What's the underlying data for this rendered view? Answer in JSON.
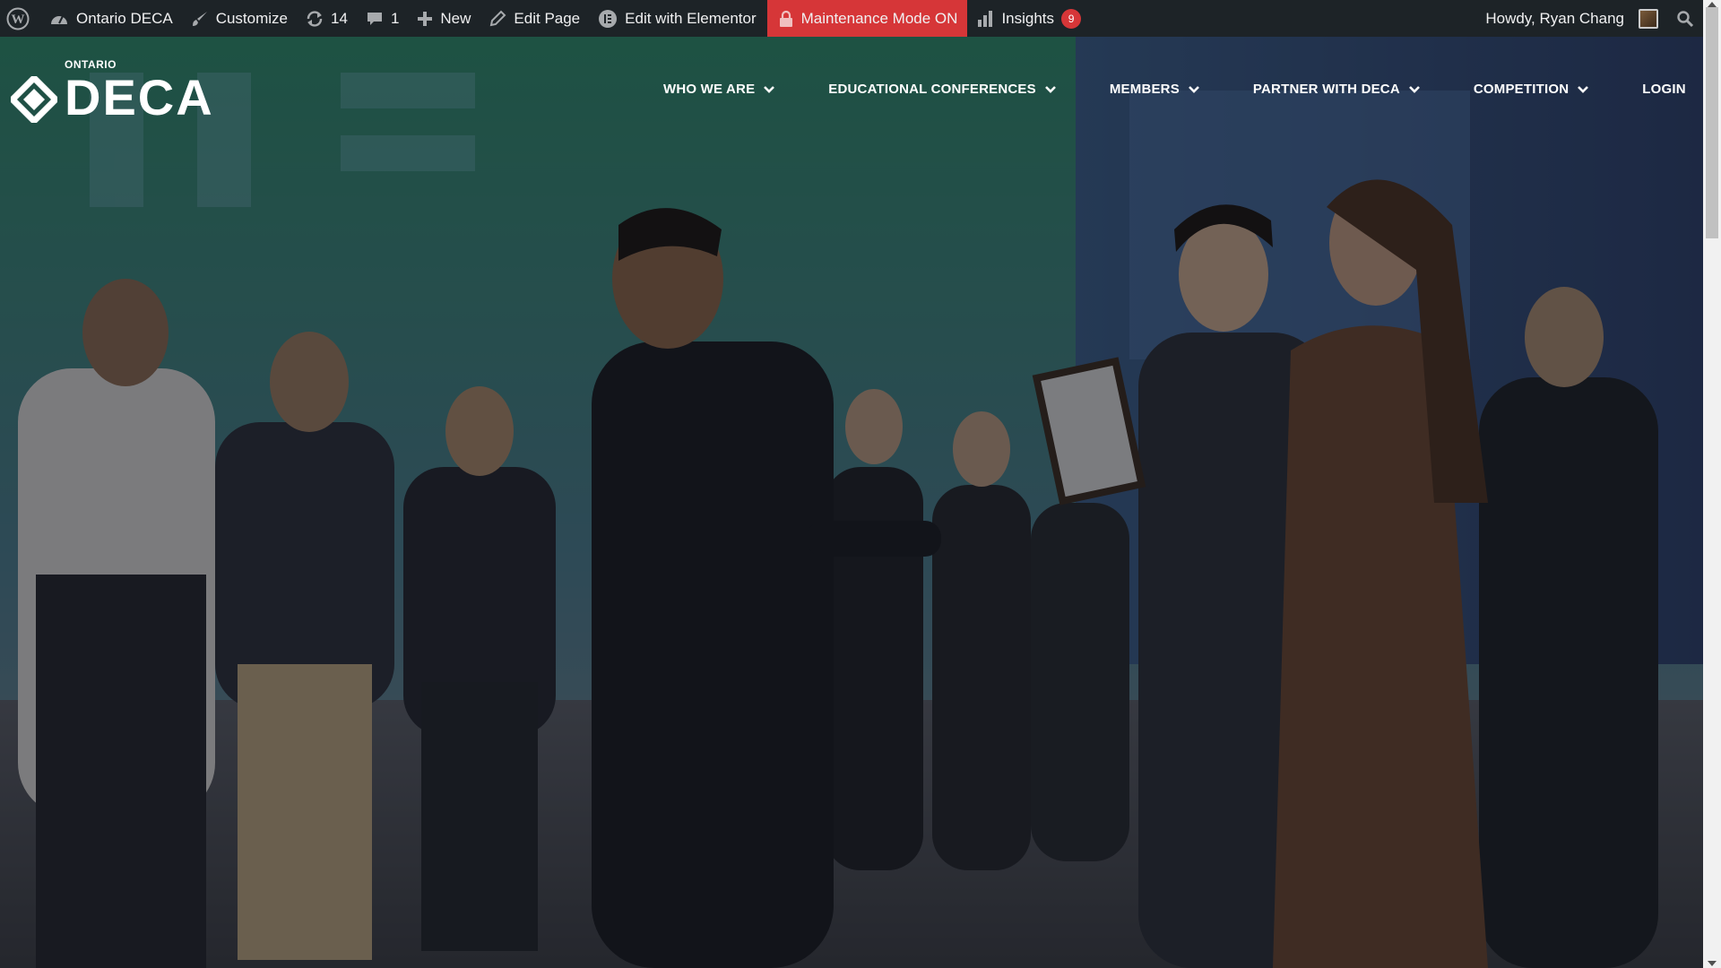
{
  "adminbar": {
    "site_name": "Ontario DECA",
    "customize": "Customize",
    "updates_count": "14",
    "comments_count": "1",
    "new_label": "New",
    "edit_page": "Edit Page",
    "edit_elementor": "Edit with Elementor",
    "maintenance": "Maintenance Mode ON",
    "insights": "Insights",
    "insights_badge": "9",
    "howdy": "Howdy, Ryan Chang"
  },
  "site": {
    "logo_small": "ONTARIO",
    "logo_big": "DECA"
  },
  "nav": {
    "items": [
      {
        "label": "WHO WE ARE",
        "has_dropdown": true
      },
      {
        "label": "EDUCATIONAL CONFERENCES",
        "has_dropdown": true
      },
      {
        "label": "MEMBERS",
        "has_dropdown": true
      },
      {
        "label": "PARTNER WITH DECA",
        "has_dropdown": true
      },
      {
        "label": "COMPETITION",
        "has_dropdown": true
      },
      {
        "label": "LOGIN",
        "has_dropdown": false
      }
    ]
  },
  "colors": {
    "adminbar_bg": "#1d2327",
    "maintenance_bg": "#d63638",
    "badge_bg": "#d63638",
    "nav_text": "#ffffff"
  },
  "icons": {
    "wordpress": "wordpress-logo-icon",
    "dashboard": "dashboard-icon",
    "customize": "paintbrush-icon",
    "updates": "refresh-icon",
    "comments": "comment-icon",
    "new": "plus-icon",
    "edit": "pencil-icon",
    "elementor": "elementor-icon",
    "lock": "lock-icon",
    "insights": "bar-chart-icon",
    "search": "search-icon"
  }
}
